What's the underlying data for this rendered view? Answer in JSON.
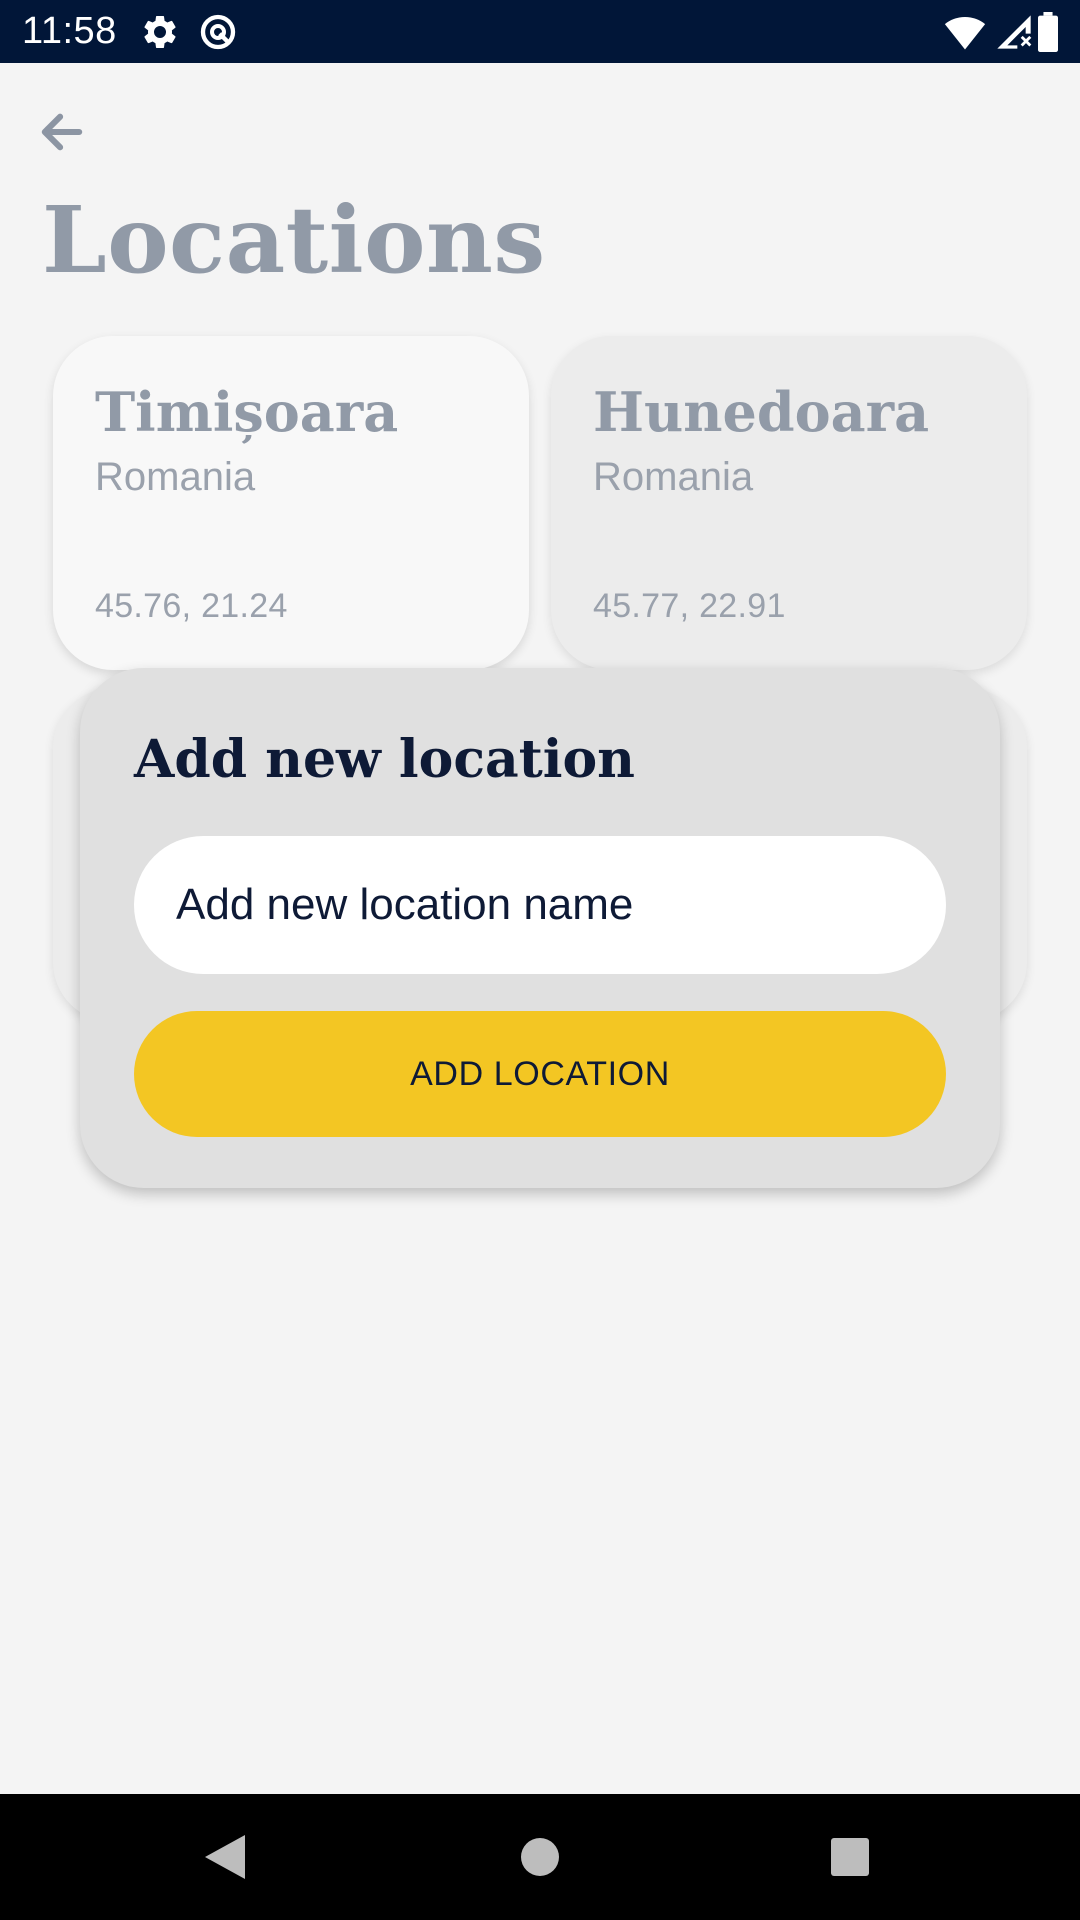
{
  "status_bar": {
    "time": "11:58",
    "icons": [
      "settings-icon",
      "data-saver-icon",
      "wifi-icon",
      "signal-icon",
      "battery-icon"
    ]
  },
  "header": {
    "back_icon": "arrow-left-icon",
    "title": "Locations"
  },
  "locations": [
    {
      "city": "Timișoara",
      "country": "Romania",
      "coords": "45.76, 21.24"
    },
    {
      "city": "Hunedoara",
      "country": "Romania",
      "coords": "45.77, 22.91"
    }
  ],
  "dialog": {
    "title": "Add new location",
    "input_placeholder": "Add new location name",
    "input_value": "",
    "button_label": "ADD LOCATION"
  },
  "nav_bar": {
    "icons": [
      "back-triangle-icon",
      "home-circle-icon",
      "recents-square-icon"
    ]
  },
  "colors": {
    "status_bar": "#011638",
    "accent": "#f3c623",
    "title_muted": "#919aa7",
    "dark_text": "#0e1a36",
    "background": "#f4f4f4"
  }
}
